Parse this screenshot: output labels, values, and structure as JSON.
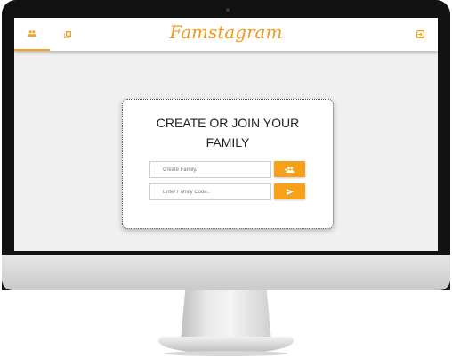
{
  "app": {
    "brand": "Famstagram"
  },
  "nav": {
    "tabs": [
      {
        "icon": "group-icon",
        "active": true
      },
      {
        "icon": "photo-library-icon",
        "active": false
      }
    ],
    "logout_icon": "logout-icon"
  },
  "card": {
    "title_line1": "CREATE OR JOIN YOUR",
    "title_line2": "FAMILY",
    "create_placeholder": "Create Family..",
    "join_placeholder": "Enter Family Code..",
    "create_button_icon": "group-add-icon",
    "join_button_icon": "send-icon"
  },
  "colors": {
    "accent": "#f7a11b",
    "brand": "#f39a1e",
    "screen_bg": "#f0f0f0"
  }
}
